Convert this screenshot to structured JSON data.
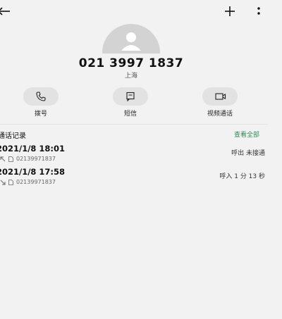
{
  "contact": {
    "number": "021 3997 1837",
    "location": "上海"
  },
  "actions": [
    {
      "label": "拨号",
      "icon": "phone-icon"
    },
    {
      "label": "短信",
      "icon": "message-icon"
    },
    {
      "label": "视频通话",
      "icon": "video-icon"
    }
  ],
  "history": {
    "title": "通话记录",
    "view_all": "查看全部",
    "calls": [
      {
        "datetime": "2021/1/8 18:01",
        "number": "02139971837",
        "status": "呼出 未接通",
        "direction": "outgoing"
      },
      {
        "datetime": "2021/1/8 17:58",
        "number": "02139971837",
        "status": "呼入 1 分 13 秒",
        "direction": "incoming"
      }
    ]
  },
  "colors": {
    "accent_green": "#2e8b57",
    "background": "#f2f2f2",
    "avatar": "#d3d3d3"
  }
}
